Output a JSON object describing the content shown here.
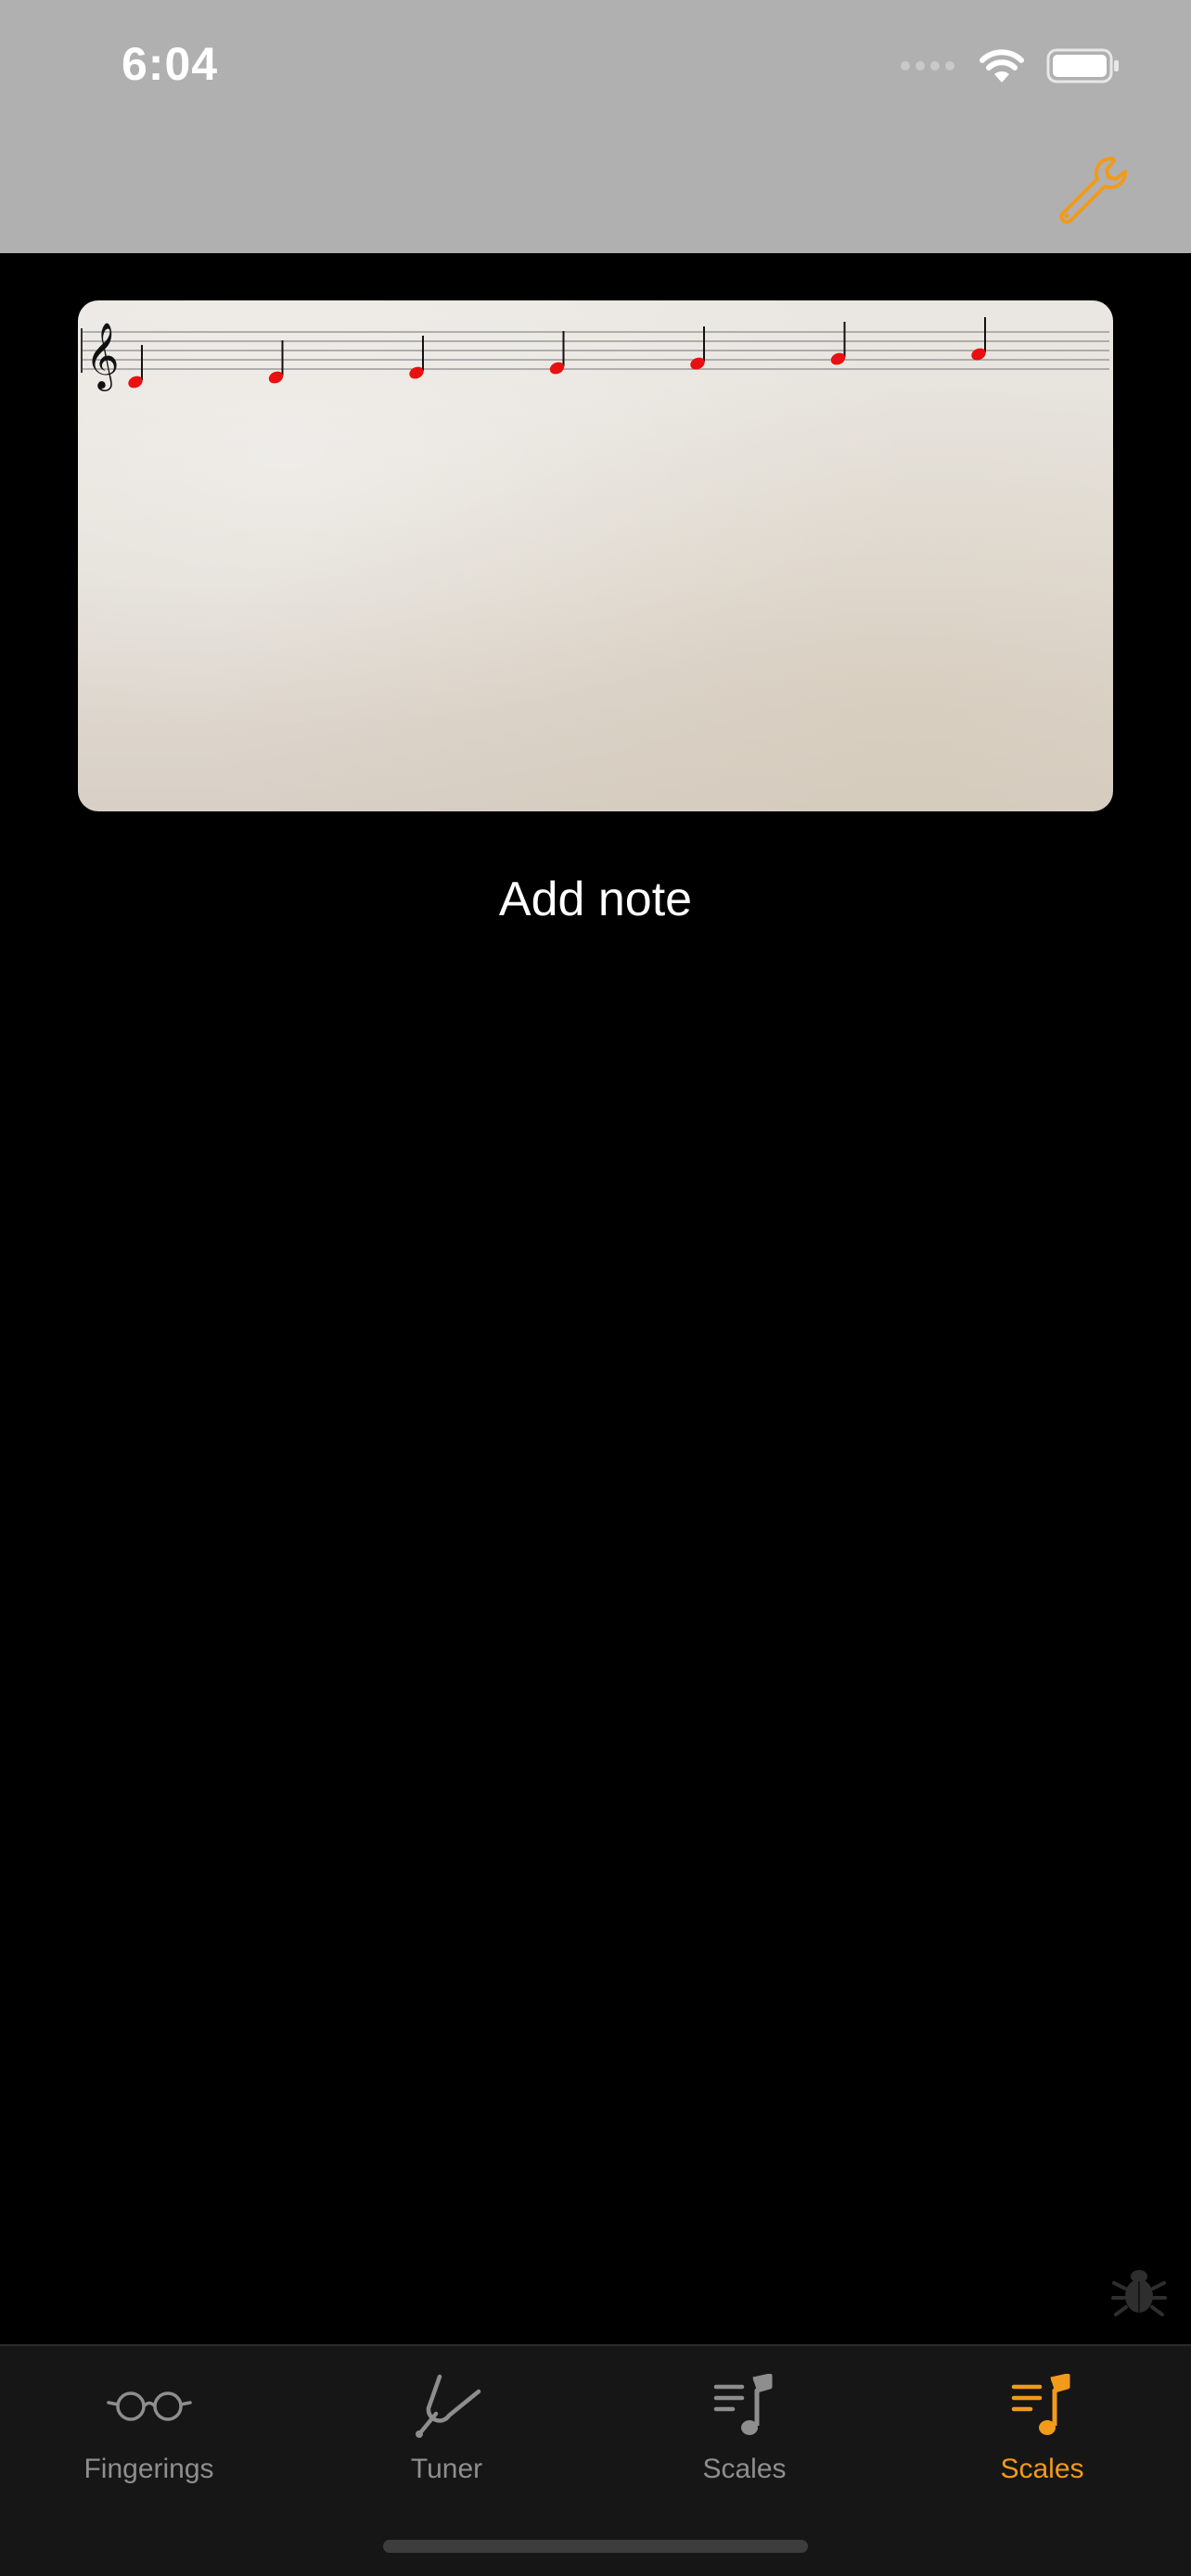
{
  "status_bar": {
    "time": "6:04",
    "signal_icon": "signal-dots-icon",
    "wifi_icon": "wifi-icon",
    "battery_icon": "battery-icon"
  },
  "toolbar": {
    "settings_icon": "wrench-icon",
    "accent_color": "#f29a1a"
  },
  "staff": {
    "clef": "treble",
    "note_color": "#e81010",
    "note_count": 7
  },
  "add_note_label": "Add note",
  "debug_icon": "bug-icon",
  "tabs": [
    {
      "label": "Fingerings",
      "icon": "glasses-icon",
      "active": false
    },
    {
      "label": "Tuner",
      "icon": "tuning-fork-icon",
      "active": false
    },
    {
      "label": "Scales",
      "icon": "music-list-icon",
      "active": false
    },
    {
      "label": "Scales",
      "icon": "music-list-icon",
      "active": true
    }
  ],
  "colors": {
    "header_bg": "#b0b0b0",
    "tab_inactive": "#8e8e8e",
    "tab_active": "#f29a1a"
  }
}
